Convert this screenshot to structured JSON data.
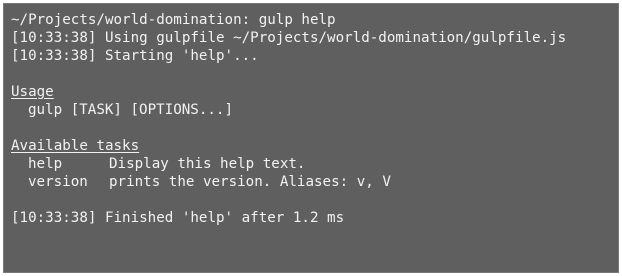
{
  "terminal": {
    "prompt_line": "~/Projects/world-domination: gulp help",
    "lines": [
      "[10:33:38] Using gulpfile ~/Projects/world-domination/gulpfile.js",
      "[10:33:38] Starting 'help'..."
    ],
    "usage_heading": "Usage",
    "usage_line": "gulp [TASK] [OPTIONS...]",
    "tasks_heading": "Available tasks",
    "tasks": [
      {
        "name": "help",
        "description": "Display this help text."
      },
      {
        "name": "version",
        "description": "prints the version. Aliases: v, V"
      }
    ],
    "finished_line": "[10:33:38] Finished 'help' after 1.2 ms"
  }
}
